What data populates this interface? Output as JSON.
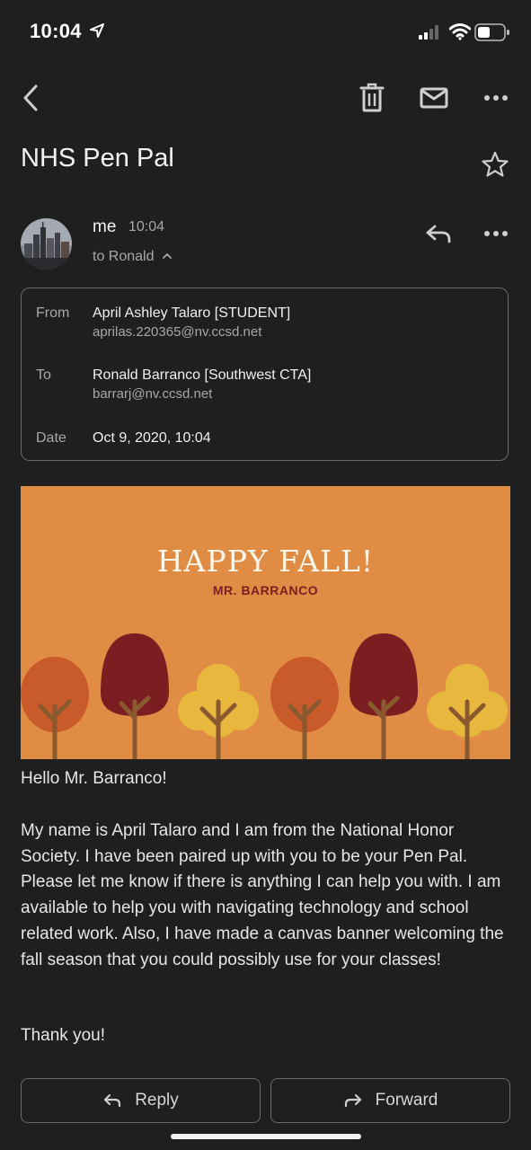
{
  "status_bar": {
    "time": "10:04"
  },
  "toolbar": {
    "icons": [
      "back-icon",
      "trash-icon",
      "mail-icon",
      "more-icon"
    ]
  },
  "email": {
    "subject": "NHS Pen Pal",
    "sender": "me",
    "sent_time": "10:04",
    "to_summary": "to Ronald",
    "details": {
      "from_label": "From",
      "from_name": "April Ashley Talaro [STUDENT]",
      "from_email": "aprilas.220365@nv.ccsd.net",
      "to_label": "To",
      "to_name": "Ronald Barranco [Southwest CTA]",
      "to_email": "barrarj@nv.ccsd.net",
      "date_label": "Date",
      "date_value": "Oct 9, 2020, 10:04"
    },
    "banner": {
      "title": "HAPPY FALL!",
      "subtitle": "MR. BARRANCO",
      "bg_color": "#e08c45"
    },
    "greeting": "Hello Mr. Barranco!",
    "paragraph": "My name is April Talaro and I am from the National Honor Society. I have been paired up with you to be your Pen Pal. Please let me know if there is anything I can help you with. I am available to help you with navigating technology and school related work. Also, I have made a canvas banner welcoming the fall season that you could possibly use for your classes!",
    "closing": "Thank you!"
  },
  "actions": {
    "reply_label": "Reply",
    "forward_label": "Forward"
  }
}
